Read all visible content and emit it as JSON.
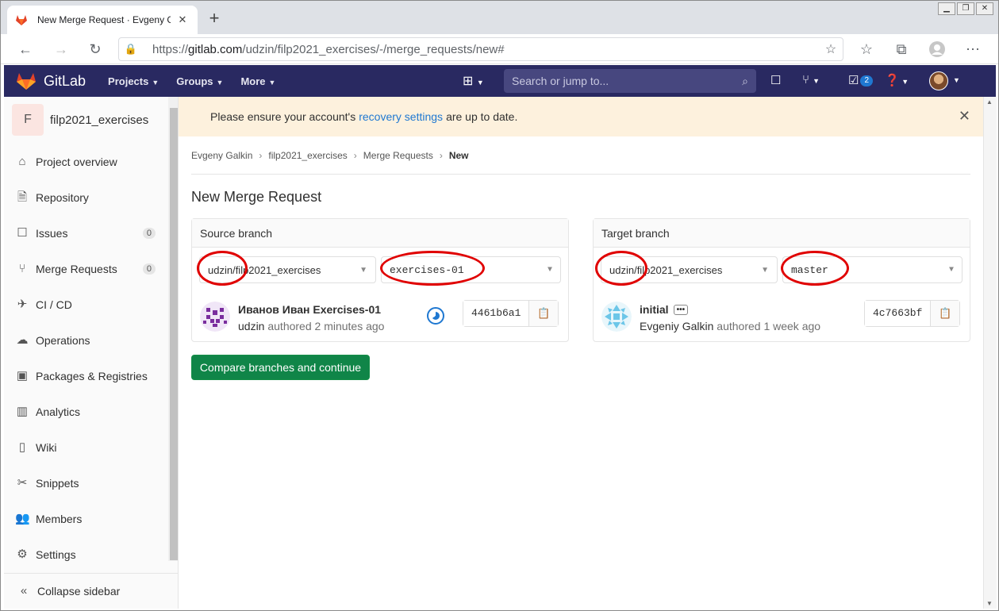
{
  "browser": {
    "tab_title": "New Merge Request · Evgeny Ga",
    "url_prefix": "https://",
    "url_host": "gitlab.com",
    "url_path": "/udzin/filp2021_exercises/-/merge_requests/new#"
  },
  "header": {
    "brand": "GitLab",
    "nav": [
      "Projects",
      "Groups",
      "More"
    ],
    "search_placeholder": "Search or jump to...",
    "todo_count": "2"
  },
  "sidebar": {
    "project_initial": "F",
    "project_name": "filp2021_exercises",
    "items": [
      {
        "label": "Project overview",
        "icon": "home-icon"
      },
      {
        "label": "Repository",
        "icon": "document-icon"
      },
      {
        "label": "Issues",
        "icon": "issues-icon",
        "count": "0"
      },
      {
        "label": "Merge Requests",
        "icon": "merge-request-icon",
        "count": "0"
      },
      {
        "label": "CI / CD",
        "icon": "rocket-icon"
      },
      {
        "label": "Operations",
        "icon": "cloud-gear-icon"
      },
      {
        "label": "Packages & Registries",
        "icon": "package-icon"
      },
      {
        "label": "Analytics",
        "icon": "chart-icon"
      },
      {
        "label": "Wiki",
        "icon": "book-icon"
      },
      {
        "label": "Snippets",
        "icon": "scissors-icon"
      },
      {
        "label": "Members",
        "icon": "users-icon"
      },
      {
        "label": "Settings",
        "icon": "gear-icon"
      }
    ],
    "collapse_label": "Collapse sidebar"
  },
  "flash": {
    "before": "Please ensure your account's",
    "link": "recovery settings",
    "after": "are up to date."
  },
  "breadcrumb": [
    "Evgeny Galkin",
    "filp2021_exercises",
    "Merge Requests",
    "New"
  ],
  "page_title": "New Merge Request",
  "source": {
    "heading": "Source branch",
    "project": "udzin/filp2021_exercises",
    "branch": "exercises-01",
    "commit_title": "Иванов Иван Exercises-01",
    "commit_author": "udzin",
    "commit_when": "authored 2 minutes ago",
    "sha": "4461b6a1"
  },
  "target": {
    "heading": "Target branch",
    "project": "udzin/filp2021_exercises",
    "branch": "master",
    "commit_title": "initial",
    "commit_author": "Evgeniy Galkin",
    "commit_when": "authored 1 week ago",
    "sha": "4c7663bf"
  },
  "compare_button": "Compare branches and continue",
  "colors": {
    "header_bg": "#292961",
    "accent": "#1f78d1",
    "success": "#108548",
    "annotation": "#e00000"
  }
}
